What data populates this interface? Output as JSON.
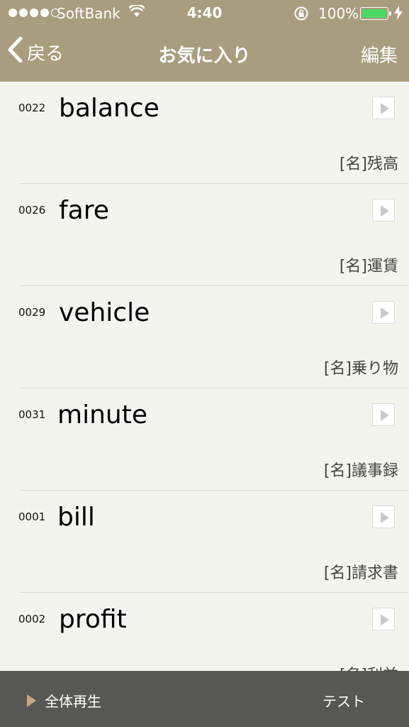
{
  "status": {
    "carrier": "SoftBank",
    "time": "4:40",
    "battery": "100%"
  },
  "nav": {
    "back_label": "戻る",
    "title": "お気に入り",
    "edit_label": "編集"
  },
  "items": [
    {
      "num": "0022",
      "word": "balance",
      "meaning": "[名]残高"
    },
    {
      "num": "0026",
      "word": "fare",
      "meaning": "[名]運賃"
    },
    {
      "num": "0029",
      "word": "vehicle",
      "meaning": "[名]乗り物"
    },
    {
      "num": "0031",
      "word": "minute",
      "meaning": "[名]議事録"
    },
    {
      "num": "0001",
      "word": "bill",
      "meaning": "[名]請求書"
    },
    {
      "num": "0002",
      "word": "profit",
      "meaning": "[名]利益"
    }
  ],
  "toolbar": {
    "play_all_label": "全体再生",
    "test_label": "テスト"
  },
  "colors": {
    "accent": "#a89d7f",
    "toolbar": "#575754",
    "battery": "#4cd964"
  }
}
